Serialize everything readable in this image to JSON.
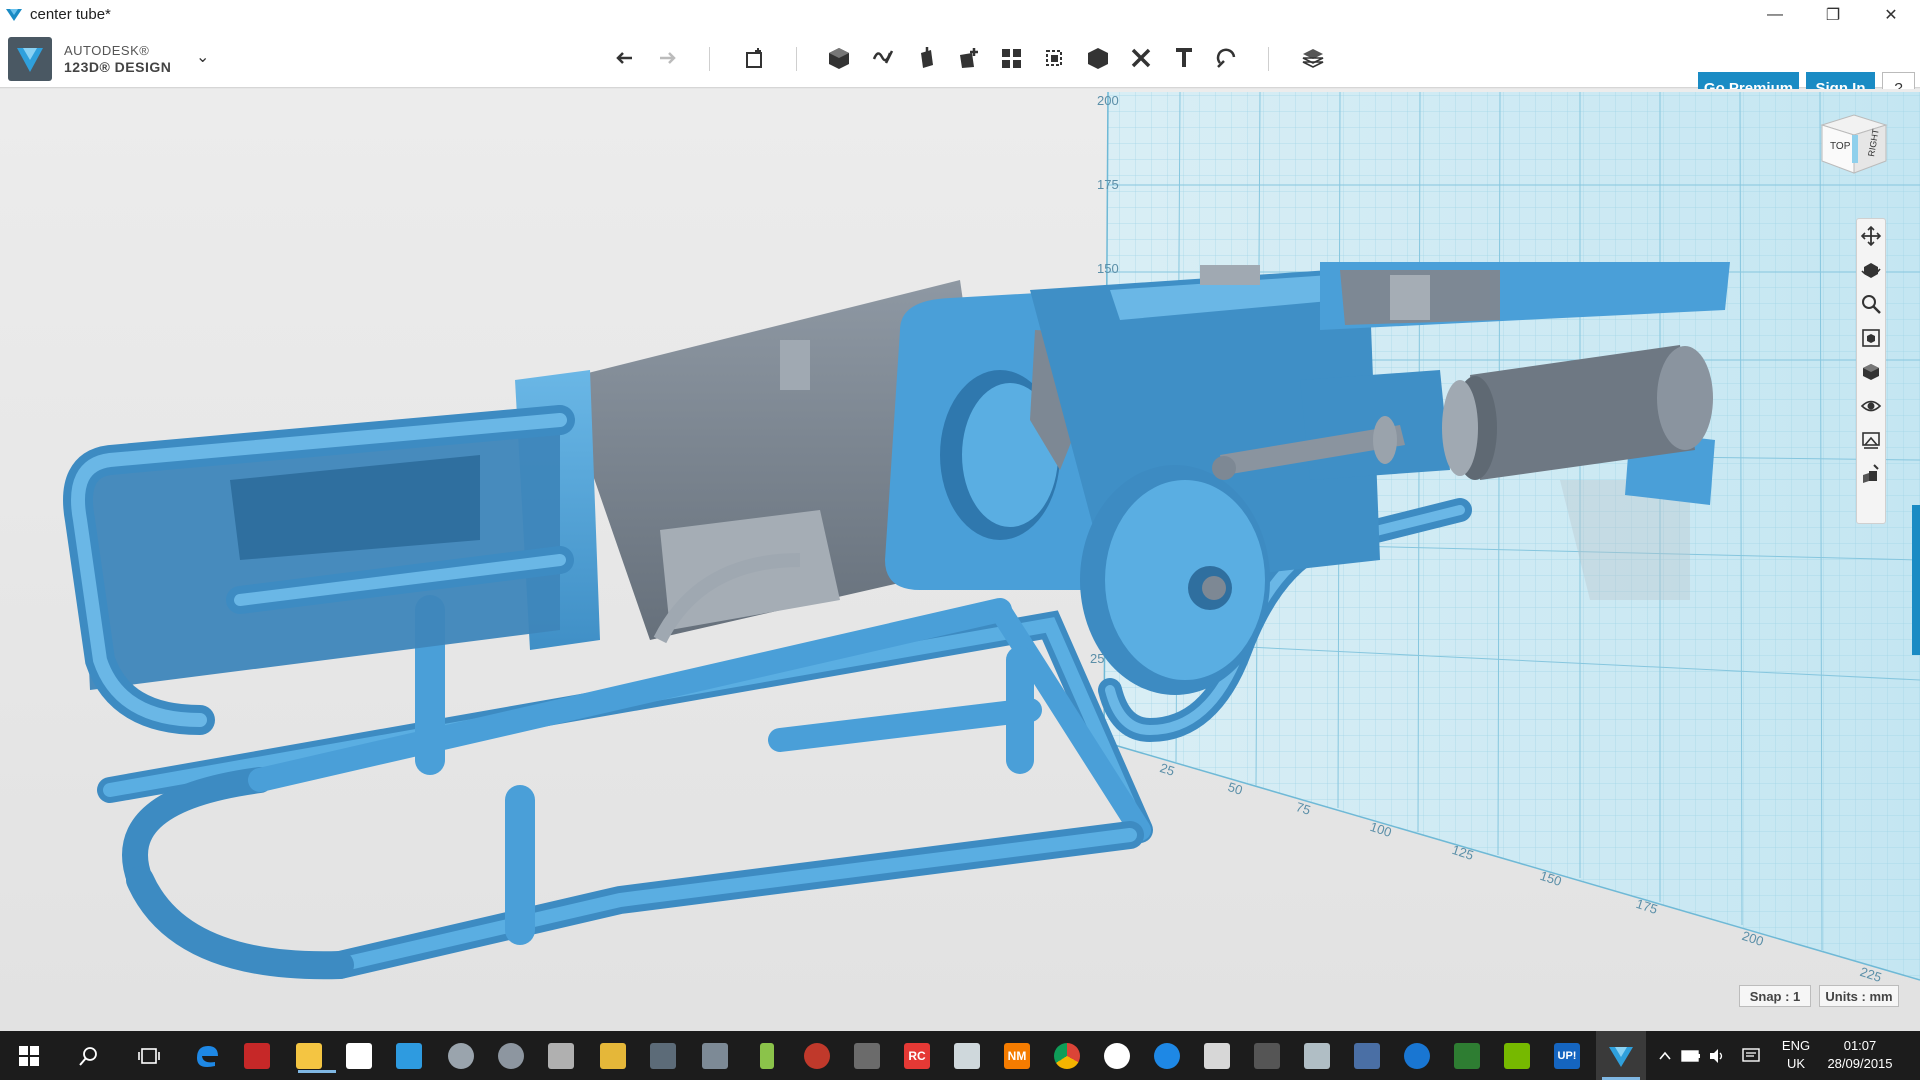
{
  "window": {
    "title": "center tube*",
    "minimize_glyph": "—",
    "maximize_glyph": "❐",
    "close_glyph": "✕"
  },
  "brand": {
    "line1": "AUTODESK®",
    "line2": "123D® DESIGN",
    "menu_glyph": "⌄"
  },
  "toolbar": {
    "tools": [
      {
        "name": "undo-icon"
      },
      {
        "name": "redo-icon"
      },
      {
        "name": "transform-icon"
      },
      {
        "name": "primitives-icon"
      },
      {
        "name": "sketch-icon"
      },
      {
        "name": "construct-icon"
      },
      {
        "name": "modify-icon"
      },
      {
        "name": "pattern-icon"
      },
      {
        "name": "grouping-icon"
      },
      {
        "name": "combine-icon"
      },
      {
        "name": "measure-icon"
      },
      {
        "name": "text-icon"
      },
      {
        "name": "snap-icon"
      },
      {
        "name": "material-icon"
      }
    ],
    "premium_label": "Go Premium",
    "signin_label": "Sign In",
    "help_label": "?"
  },
  "viewcube": {
    "top_label": "TOP",
    "right_label": "RIGHT"
  },
  "grid": {
    "vertical_ticks": [
      "200",
      "175",
      "150",
      "25"
    ],
    "horizontal_ticks": [
      "25",
      "50",
      "75",
      "100",
      "125",
      "150",
      "175",
      "200",
      "225"
    ]
  },
  "nav_tools": [
    "pan-icon",
    "orbit-icon",
    "zoom-icon",
    "fit-icon",
    "view-mode-icon",
    "visibility-icon",
    "materials-outline-icon",
    "model-settings-icon"
  ],
  "status": {
    "snap": "Snap : 1",
    "units": "Units : mm"
  },
  "taskbar": {
    "lang_line1": "ENG",
    "lang_line2": "UK",
    "time": "01:07",
    "date": "28/09/2015",
    "rc_label": "RC",
    "nm_label": "NM",
    "up_label": "UP!"
  },
  "colors": {
    "accent": "#1a8bc4",
    "model_blue": "#4a9fd8",
    "model_grey": "#7d8894",
    "grid": "#7ec7e0"
  }
}
